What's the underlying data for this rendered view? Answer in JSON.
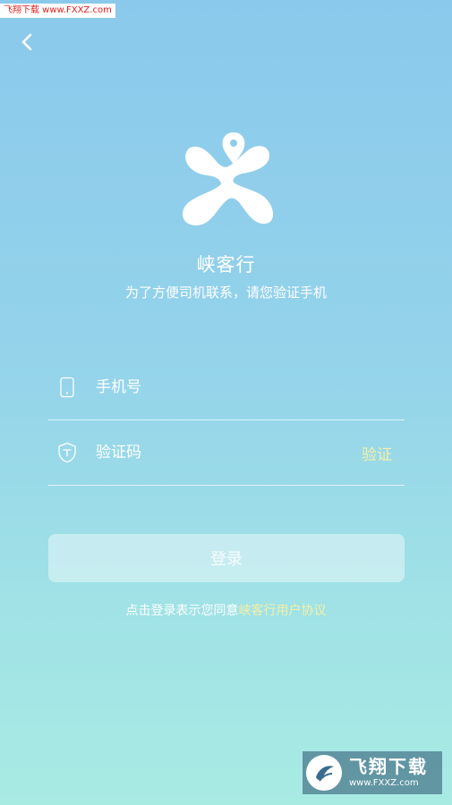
{
  "watermark_top": "飞翔下载 www.FXXZ.com",
  "header": {
    "back_icon": "chevron-left-icon"
  },
  "brand": {
    "logo_icon": "xia-logo-icon",
    "app_name": "峡客行",
    "subtitle": "为了方便司机联系，请您验证手机"
  },
  "form": {
    "phone": {
      "icon": "phone-icon",
      "placeholder": "手机号",
      "value": ""
    },
    "code": {
      "icon": "shield-icon",
      "placeholder": "验证码",
      "value": "",
      "verify_label": "验证"
    },
    "login_label": "登录"
  },
  "agreement": {
    "prefix": "点击登录表示您同意",
    "link": "峡客行用户协议"
  },
  "watermark_bottom": {
    "name": "飞翔下载",
    "url": "www.FXXZ.com"
  },
  "colors": {
    "accent_yellow": "#F3F0A8",
    "background_top": "#8BC9EC",
    "background_bottom": "#A8EBE3"
  }
}
